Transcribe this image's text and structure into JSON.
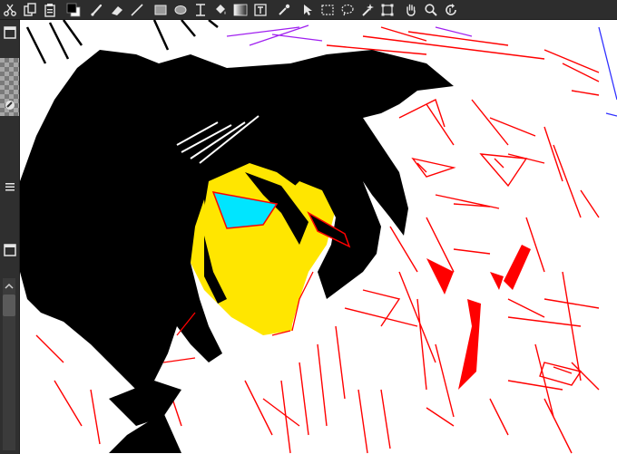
{
  "toolbar": {
    "tools": [
      {
        "id": "cut",
        "icon": "scissors-icon"
      },
      {
        "id": "copy",
        "icon": "copy-icon"
      },
      {
        "id": "paste",
        "icon": "clipboard-icon"
      },
      {
        "id": "colors",
        "icon": "color-swatch-icon"
      },
      {
        "id": "brush",
        "icon": "brush-icon"
      },
      {
        "id": "eraser",
        "icon": "eraser-icon"
      },
      {
        "id": "line",
        "icon": "line-icon"
      },
      {
        "id": "rectangle",
        "icon": "rectangle-icon"
      },
      {
        "id": "ellipse",
        "icon": "ellipse-icon"
      },
      {
        "id": "text-tool",
        "icon": "text-cursor-icon"
      },
      {
        "id": "fill",
        "icon": "bucket-icon"
      },
      {
        "id": "gradient",
        "icon": "gradient-icon"
      },
      {
        "id": "text-frame",
        "icon": "text-frame-icon"
      },
      {
        "id": "eyedropper",
        "icon": "eyedropper-icon"
      },
      {
        "id": "move",
        "icon": "arrow-cursor-icon"
      },
      {
        "id": "select-rect",
        "icon": "rect-select-icon"
      },
      {
        "id": "select-lasso",
        "icon": "lasso-icon"
      },
      {
        "id": "magic-wand",
        "icon": "magic-wand-icon"
      },
      {
        "id": "transform",
        "icon": "transform-icon"
      },
      {
        "id": "pan",
        "icon": "hand-icon"
      },
      {
        "id": "zoom",
        "icon": "magnifier-icon"
      },
      {
        "id": "rotate",
        "icon": "rotate-icon"
      }
    ],
    "colors": {
      "foreground": "#000000",
      "background": "#ffffff"
    }
  },
  "left_panel": {
    "icons": [
      "layers-window-icon",
      "brush-dropper-icon",
      "layer-list-icon",
      "navigator-window-icon"
    ]
  },
  "theme": {
    "toolbar_bg": "#2d2d2d",
    "panel_bg": "#2f2f2f",
    "icon_color": "#e6e6e6"
  },
  "canvas": {
    "colors": {
      "hair": "#000000",
      "skin": "#ffe600",
      "eye": "#00e5ff",
      "sketch_red": "#ff0000",
      "sketch_purple": "#a020f0",
      "sketch_blue": "#3030ff"
    }
  }
}
